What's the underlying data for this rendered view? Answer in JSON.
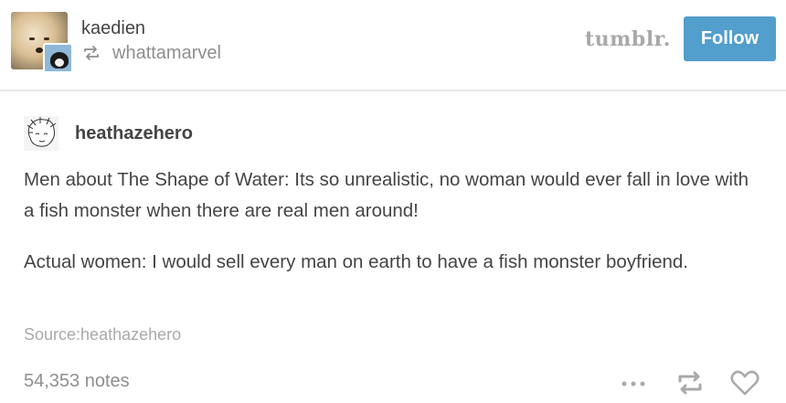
{
  "header": {
    "username": "kaedien",
    "reblogged_from": "whattamarvel",
    "brand_logo_text": "tumblr.",
    "follow_label": "Follow"
  },
  "post": {
    "author": "heathazehero",
    "paragraphs": [
      "Men about The Shape of Water: Its so unrealistic, no woman would ever fall in love with a fish monster when there are real men around!",
      "Actual women: I would sell every man on earth to have a fish monster boyfriend."
    ],
    "source_label": "Source:",
    "source_name": "heathazehero",
    "notes": "54,353 notes"
  },
  "icons": {
    "reblog_small": "reblog-icon",
    "more": "ellipsis-icon",
    "reblog": "reblog-icon",
    "like": "heart-icon"
  },
  "colors": {
    "follow_button": "#529ecc",
    "divider": "#e7e7e7",
    "text": "#444444",
    "muted": "#8e8e8e"
  }
}
